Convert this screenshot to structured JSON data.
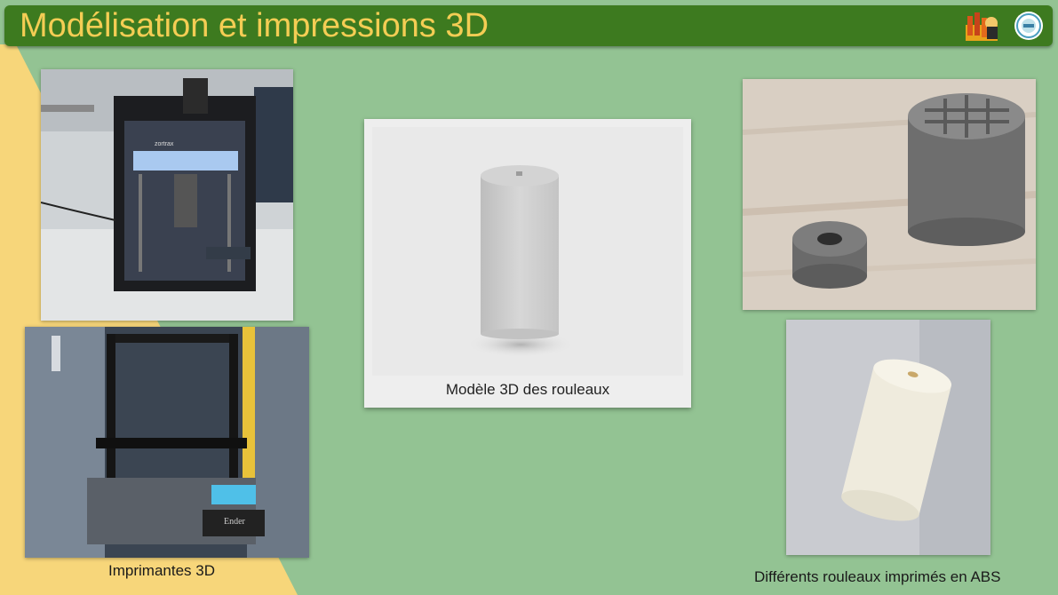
{
  "slide": {
    "title": "Modélisation et impressions 3D",
    "colors": {
      "background": "#93c393",
      "title_bar": "#3d7a1f",
      "title_text": "#f4cd54",
      "accent_band": "#f7d67a"
    }
  },
  "logos": [
    {
      "icon": "team-mascot-logo"
    },
    {
      "icon": "circular-badge-logo"
    }
  ],
  "photos": [
    {
      "icon": "zortrax-3d-printer-photo",
      "brand_text": "zortrax"
    },
    {
      "icon": "ender-3d-printer-photo",
      "brand_text": "Ender"
    },
    {
      "icon": "gray-printed-rollers-photo"
    },
    {
      "icon": "white-printed-roller-photo"
    }
  ],
  "model_card": {
    "icon": "cylinder-3d-model-render",
    "caption": "Modèle 3D des rouleaux"
  },
  "captions": {
    "printers": "Imprimantes 3D",
    "rollers": "Différents rouleaux imprimés en ABS"
  }
}
